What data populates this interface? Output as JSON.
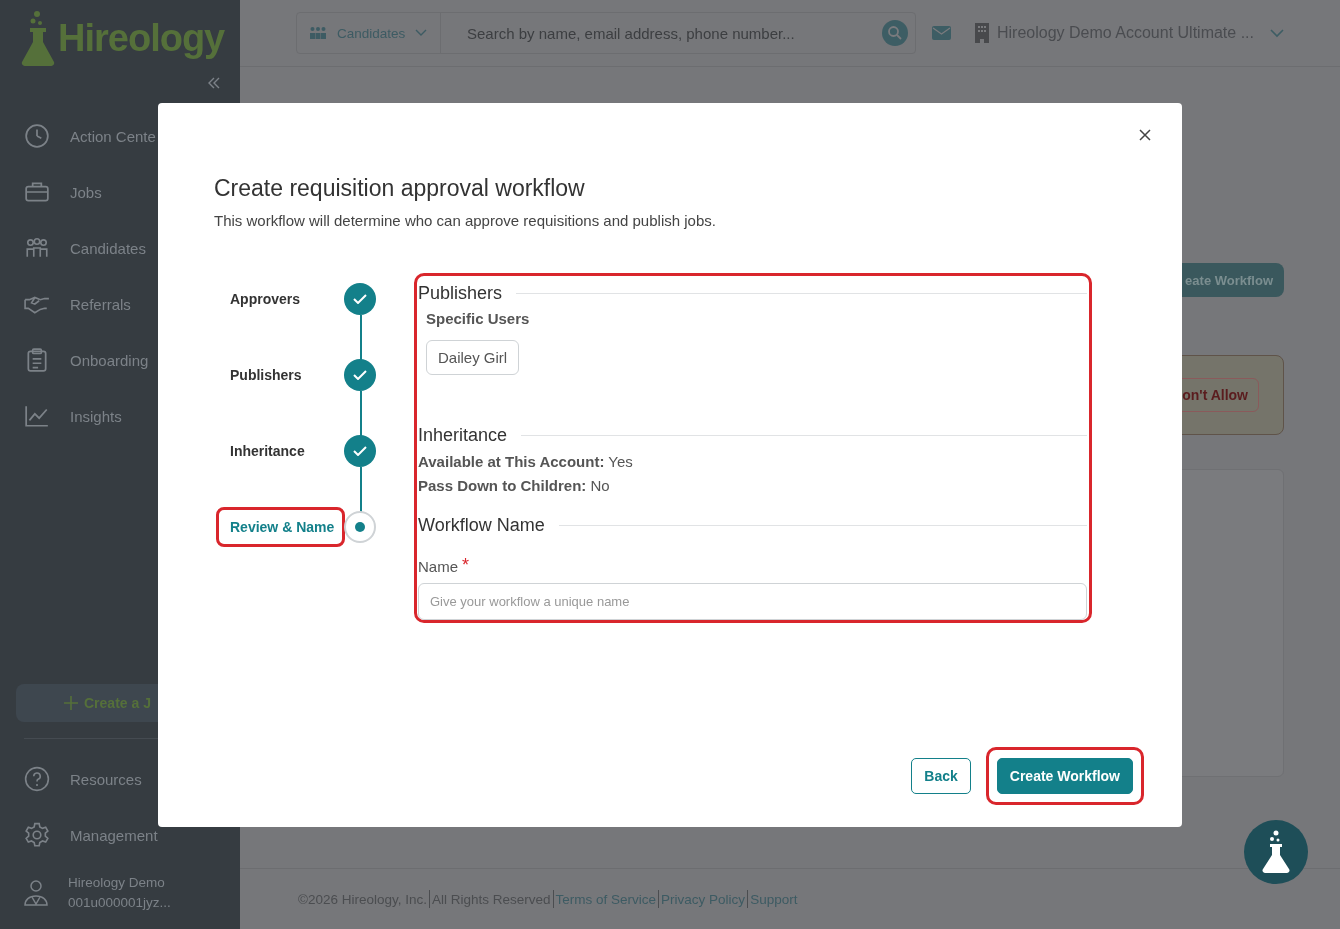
{
  "sidebar": {
    "logo": "Hireology",
    "items": [
      {
        "label": "Action Cente",
        "kind": "dial"
      },
      {
        "label": "Jobs",
        "kind": "briefcase"
      },
      {
        "label": "Candidates",
        "kind": "people"
      },
      {
        "label": "Referrals",
        "kind": "handshake"
      },
      {
        "label": "Onboarding",
        "kind": "clipboard"
      },
      {
        "label": "Insights",
        "kind": "chart"
      }
    ],
    "create_button": "Create a J",
    "bottom_items": [
      {
        "label": "Resources",
        "kind": "help"
      },
      {
        "label": "Management",
        "kind": "gear"
      }
    ],
    "user": {
      "name": "Hireology Demo",
      "account_id": "001u000001jyz..."
    }
  },
  "header": {
    "scope": "Candidates",
    "search_placeholder": "Search by name, email address, phone number...",
    "account": "Hireology Demo Account Ultimate ..."
  },
  "page": {
    "create_button": "eate Workflow",
    "deny_button": "on't Allow"
  },
  "modal": {
    "title": "Create requisition approval workflow",
    "subtitle": "This workflow will determine who can approve requisitions and publish jobs.",
    "steps": [
      {
        "label": "Approvers",
        "completed": true,
        "selected": false,
        "highlighted": false
      },
      {
        "label": "Publishers",
        "completed": true,
        "selected": false,
        "highlighted": false
      },
      {
        "label": "Inheritance",
        "completed": true,
        "selected": false,
        "highlighted": false
      },
      {
        "label": "Review & Name",
        "completed": false,
        "selected": true,
        "highlighted": true
      }
    ],
    "review": {
      "highlighted": true,
      "publishers": {
        "heading": "Publishers",
        "type_label": "Specific Users",
        "users": [
          "Dailey Girl"
        ]
      },
      "inheritance": {
        "heading": "Inheritance",
        "lines": [
          "**Available at This Account:** Yes",
          "**Pass Down to Children:** No"
        ]
      },
      "workflow_name": {
        "heading": "Workflow Name",
        "field_label": "Name",
        "required_mark": "*",
        "placeholder": "Give your workflow a unique name"
      }
    },
    "buttons": [
      {
        "label": "Back",
        "kind": "secondary",
        "highlighted": false
      },
      {
        "label": "Create Workflow",
        "kind": "primary",
        "highlighted": true
      }
    ]
  },
  "footer": [
    {
      "text": "©2026 Hireology, Inc.",
      "kind": "text"
    },
    {
      "text": "All Rights Reserved",
      "kind": "text"
    },
    {
      "text": "Terms of Service",
      "kind": "link"
    },
    {
      "text": "Privacy Policy",
      "kind": "link"
    },
    {
      "text": "Support",
      "kind": "link"
    }
  ]
}
